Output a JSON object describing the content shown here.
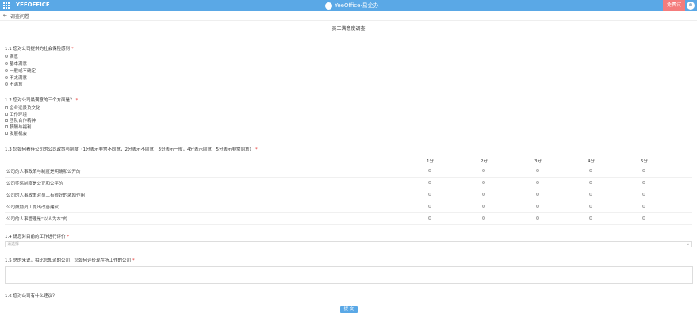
{
  "header": {
    "brand": "YEEOFFICE",
    "center_title": "YeeOffice·易企办",
    "trial_label": "免费试",
    "accent": "#5aa8e6",
    "trial_color": "#f47c7c"
  },
  "breadcrumb": {
    "back_icon": "arrow-left-icon",
    "label": "调查问卷"
  },
  "survey": {
    "title": "员工满意度调查"
  },
  "questions": {
    "q1": {
      "text": "1.1  您对公司提供的社会保险感到",
      "options": [
        "满意",
        "基本满意",
        "一般或不确定",
        "不太满意",
        "不满意"
      ]
    },
    "q2": {
      "text": "1.2  您对公司最满意的三个方面是？",
      "options": [
        "企业远景及文化",
        "工作环境",
        "团队合作精神",
        "薪酬与福利",
        "发展机会"
      ]
    },
    "q3": {
      "text": "1.3  您如何看待公司的公司政策与制度（1分表示非常不同意，2分表示不同意，3分表示一般，4分表示同意，5分表示非常同意）",
      "scale": [
        "1分",
        "2分",
        "3分",
        "4分",
        "5分"
      ],
      "rows": [
        "公司的人事政策与制度是明确和公开的",
        "公司奖惩制度是公正和公平的",
        "公司的人事政策对员工有很好的激励作用",
        "公司鼓励员工提出改善建议",
        "公司的人事管理是“以人为本”的"
      ]
    },
    "q4": {
      "text": "1.4  请您对目前的工作进行评价",
      "placeholder": "请选择"
    },
    "q5": {
      "text": "1.5  总的来说，相比您知道的公司，您如何评价现在所工作的公司"
    },
    "q6": {
      "text": "1.6  您对公司有什么建议？"
    }
  },
  "submit_label": "提 交"
}
